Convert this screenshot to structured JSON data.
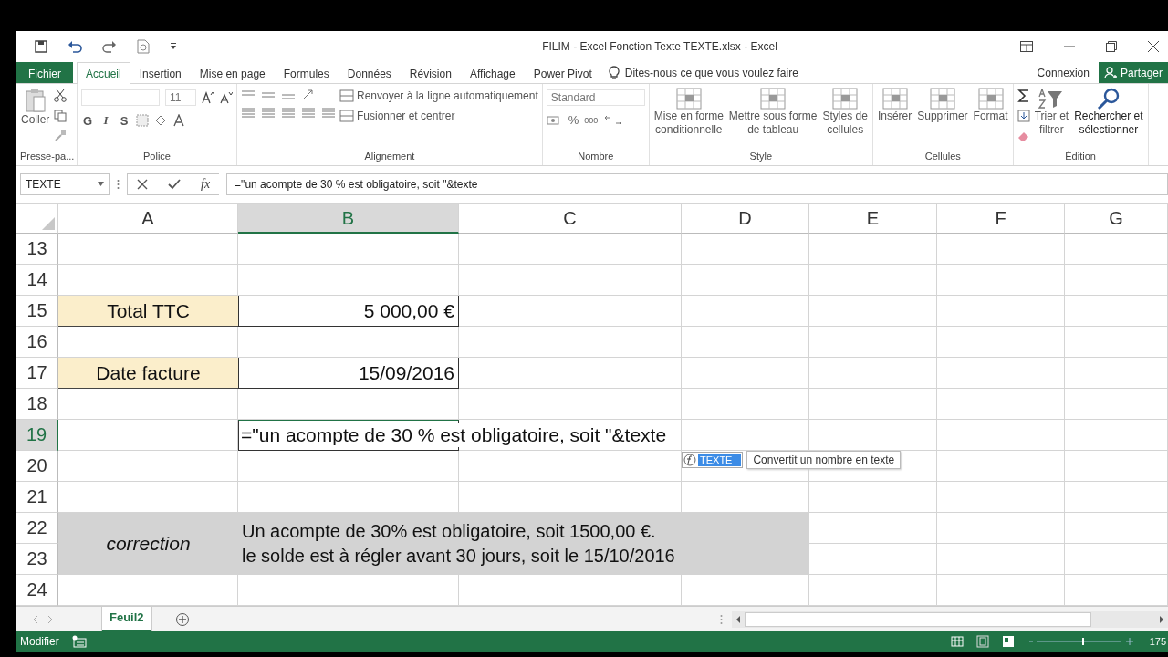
{
  "window": {
    "title": "FILIM - Excel Fonction Texte TEXTE.xlsx - Excel"
  },
  "tabs": [
    {
      "label": "Fichier",
      "kind": "file",
      "selected": false
    },
    {
      "label": "Accueil",
      "kind": "tab",
      "selected": true
    },
    {
      "label": "Insertion",
      "kind": "tab",
      "selected": false
    },
    {
      "label": "Mise en page",
      "kind": "tab",
      "selected": false
    },
    {
      "label": "Formules",
      "kind": "tab",
      "selected": false
    },
    {
      "label": "Données",
      "kind": "tab",
      "selected": false
    },
    {
      "label": "Révision",
      "kind": "tab",
      "selected": false
    },
    {
      "label": "Affichage",
      "kind": "tab",
      "selected": false
    },
    {
      "label": "Power Pivot",
      "kind": "tab",
      "selected": false
    }
  ],
  "tell_me": {
    "placeholder": "Dites-nous ce que vous voulez faire"
  },
  "account": {
    "sign_in": "Connexion",
    "share": "Partager"
  },
  "ribbon": {
    "groups": [
      {
        "name": "Presse-pa...",
        "kind": "clipboard",
        "items": [
          {
            "label_lines": [
              "Coller"
            ]
          }
        ]
      },
      {
        "name": "Police",
        "kind": "font",
        "font_size": "11",
        "items": [
          {
            "label_lines": [
              "G"
            ]
          },
          {
            "label_lines": [
              "I"
            ]
          },
          {
            "label_lines": [
              "S"
            ]
          }
        ]
      },
      {
        "name": "Alignement",
        "kind": "align",
        "items": [
          {
            "label_lines": [
              "Renvoyer à la ligne automatiquement"
            ]
          },
          {
            "label_lines": [
              "Fusionner et centrer"
            ]
          }
        ]
      },
      {
        "name": "Nombre",
        "kind": "number",
        "format": "Standard",
        "items": [
          {
            "label_lines": [
              "%"
            ]
          },
          {
            "label_lines": [
              "000"
            ]
          }
        ]
      },
      {
        "name": "Style",
        "kind": "large",
        "items": [
          {
            "label_lines": [
              "Mise en forme",
              "conditionnelle"
            ]
          },
          {
            "label_lines": [
              "Mettre sous forme",
              "de tableau"
            ]
          },
          {
            "label_lines": [
              "Styles de",
              "cellules"
            ]
          }
        ]
      },
      {
        "name": "Cellules",
        "kind": "large",
        "items": [
          {
            "label_lines": [
              "Insérer"
            ]
          },
          {
            "label_lines": [
              "Supprimer"
            ]
          },
          {
            "label_lines": [
              "Format"
            ]
          }
        ]
      },
      {
        "name": "Édition",
        "kind": "edit",
        "items": [
          {
            "label_lines": [
              "Trier et",
              "filtrer"
            ]
          },
          {
            "label_lines": [
              "Rechercher et",
              "sélectionner"
            ]
          }
        ]
      }
    ]
  },
  "formula_bar": {
    "name_box": "TEXTE",
    "insert_function": "fx",
    "formula": "=\"un acompte de 30 % est obligatoire, soit \"&texte"
  },
  "sheet": {
    "columns": [
      {
        "label": "A",
        "selected": false
      },
      {
        "label": "B",
        "selected": true
      },
      {
        "label": "C",
        "selected": false
      },
      {
        "label": "D",
        "selected": false
      },
      {
        "label": "E",
        "selected": false
      },
      {
        "label": "F",
        "selected": false
      },
      {
        "label": "G",
        "selected": false
      }
    ],
    "rows": [
      {
        "number": "13",
        "selected": false,
        "cells": []
      },
      {
        "number": "14",
        "selected": false,
        "cells": []
      },
      {
        "number": "15",
        "selected": false,
        "cells": [
          {
            "kind": "label",
            "text": "Total TTC"
          },
          {
            "kind": "value",
            "text": "5 000,00 €"
          }
        ]
      },
      {
        "number": "16",
        "selected": false,
        "cells": []
      },
      {
        "number": "17",
        "selected": false,
        "cells": [
          {
            "kind": "label",
            "text": "Date facture"
          },
          {
            "kind": "value",
            "text": "15/09/2016"
          }
        ]
      },
      {
        "number": "18",
        "selected": false,
        "cells": []
      },
      {
        "number": "19",
        "selected": true,
        "cells": [
          "",
          {
            "kind": "editing",
            "text": "=\"un acompte de 30 % est obligatoire, soit \"&texte"
          }
        ]
      },
      {
        "number": "20",
        "selected": false,
        "cells": []
      },
      {
        "number": "21",
        "selected": false,
        "cells": []
      },
      {
        "number": "22",
        "selected": false,
        "cells": [
          {
            "kind": "note",
            "text": "correction"
          },
          {
            "kind": "note-text",
            "lines": [
              "Un acompte de 30% est obligatoire, soit 1500,00 €.",
              "le solde est à régler avant 30 jours, soit le 15/10/2016"
            ]
          }
        ]
      },
      {
        "number": "23",
        "selected": false,
        "cells": []
      },
      {
        "number": "24",
        "selected": false,
        "cells": []
      }
    ],
    "autocomplete": {
      "function": "TEXTE",
      "tooltip": "Convertit un nombre en texte"
    }
  },
  "sheet_tabs": [
    {
      "label": "Feuil2",
      "selected": true
    }
  ],
  "status_bar": {
    "mode": "Modifier",
    "zoom": "175"
  }
}
